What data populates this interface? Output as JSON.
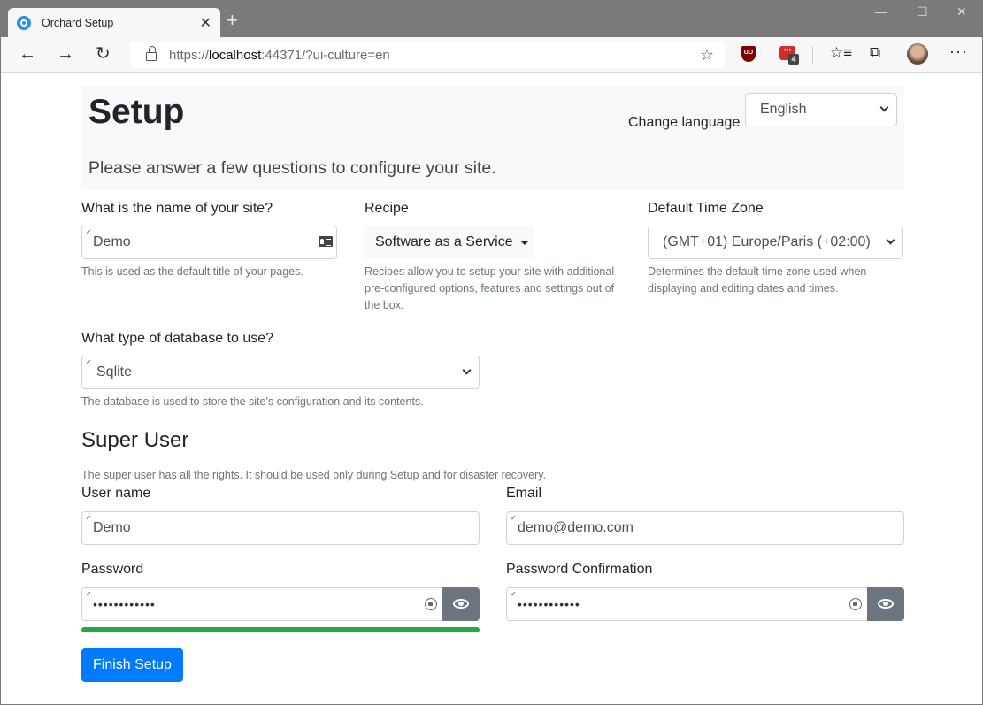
{
  "browser": {
    "tab_title": "Orchard Setup",
    "url_scheme": "https://",
    "url_host": "localhost",
    "url_rest": ":44371/?ui-culture=en",
    "extension_badge": "4"
  },
  "header": {
    "title": "Setup",
    "lead": "Please answer a few questions to configure your site.",
    "language_label": "Change language",
    "language_value": "English"
  },
  "site": {
    "label": "What is the name of your site?",
    "value": "Demo",
    "help": "This is used as the default title of your pages."
  },
  "recipe": {
    "label": "Recipe",
    "value": "Software as a Service",
    "help": "Recipes allow you to setup your site with additional pre-configured options, features and settings out of the box."
  },
  "timezone": {
    "label": "Default Time Zone",
    "value": "(GMT+01) Europe/Paris (+02:00)",
    "help": "Determines the default time zone used when displaying and editing dates and times."
  },
  "database": {
    "label": "What type of database to use?",
    "value": "Sqlite",
    "help": "The database is used to store the site's configuration and its contents."
  },
  "super_user": {
    "heading": "Super User",
    "help": "The super user has all the rights. It should be used only during Setup and for disaster recovery.",
    "username_label": "User name",
    "username_value": "Demo",
    "email_label": "Email",
    "email_value": "demo@demo.com",
    "password_label": "Password",
    "password_value": "••••••••••••",
    "password_confirm_label": "Password Confirmation",
    "password_confirm_value": "••••••••••••",
    "password_strength_percent": 100
  },
  "actions": {
    "finish_label": "Finish Setup"
  },
  "colors": {
    "primary": "#007bff",
    "success": "#28a745",
    "secondary": "#6c757d"
  }
}
